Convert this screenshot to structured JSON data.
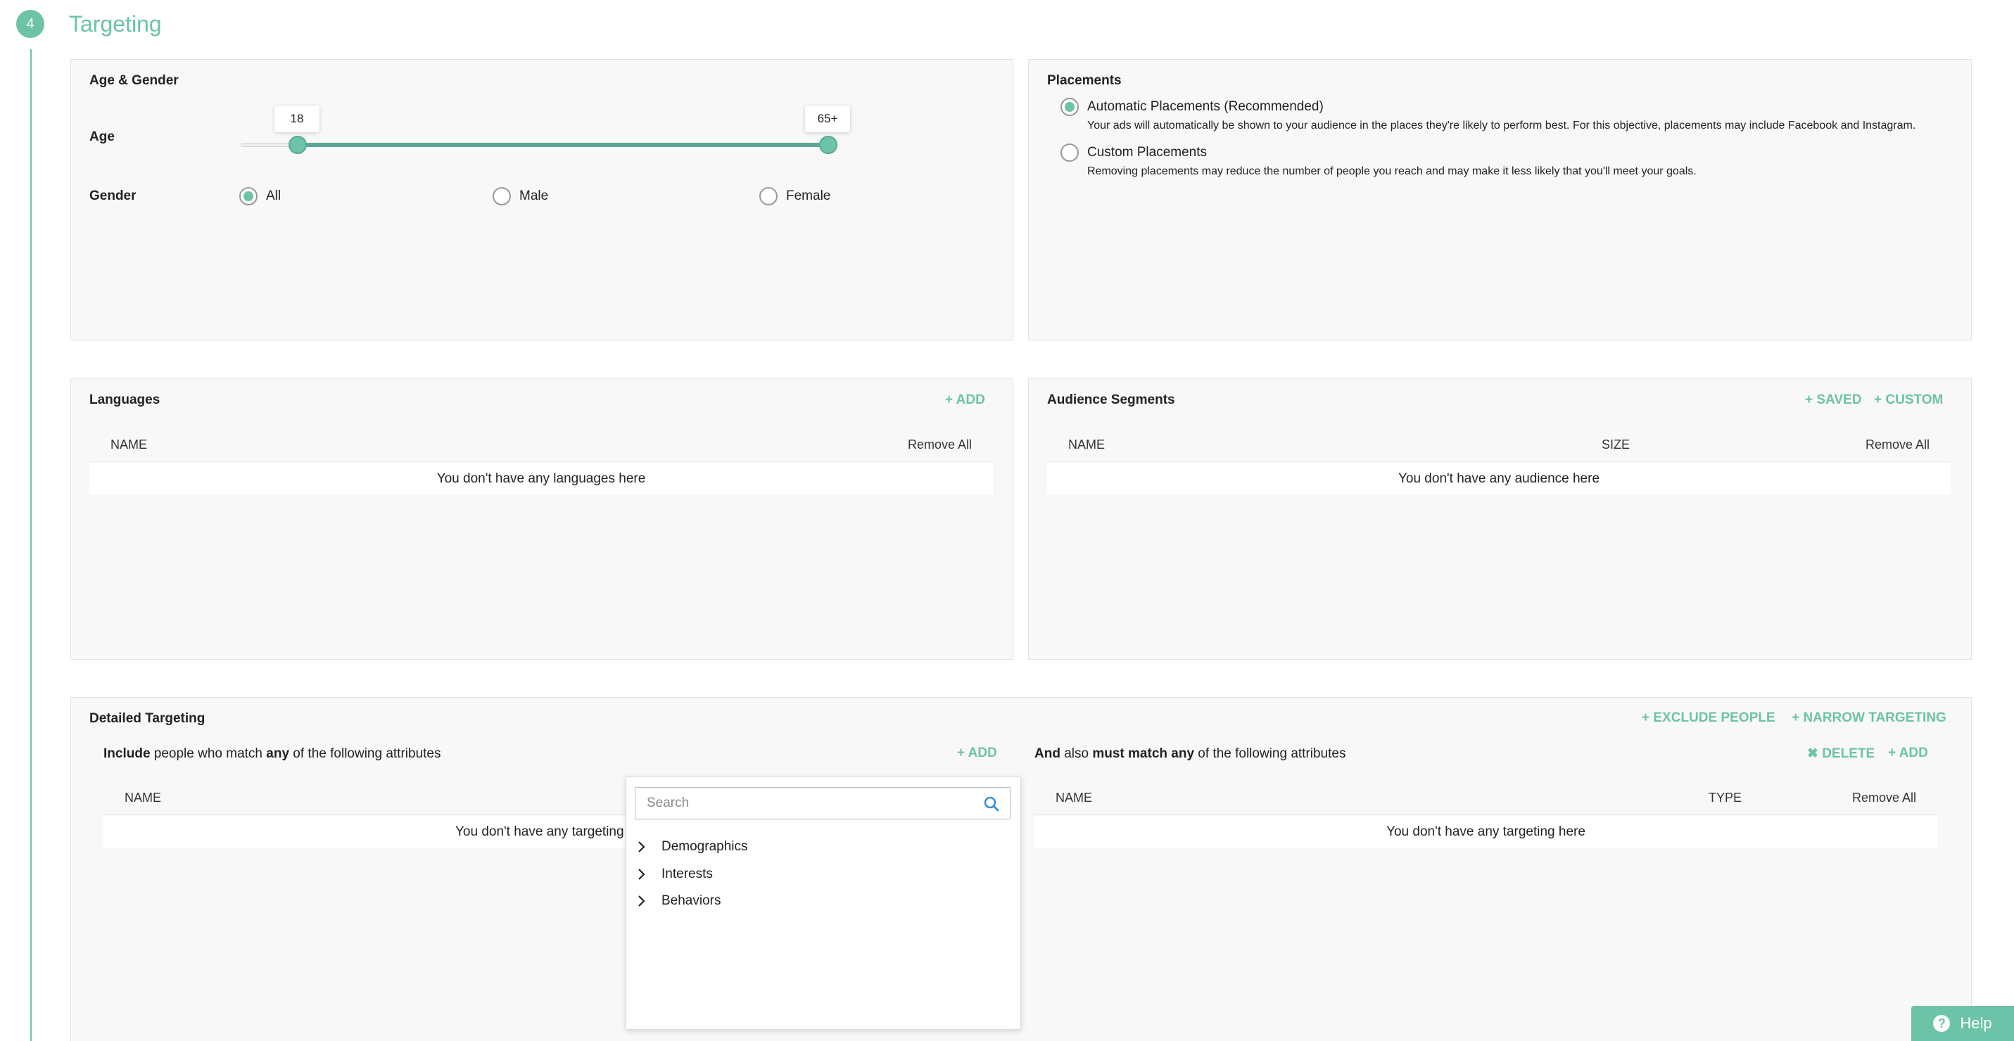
{
  "step": {
    "number": "4",
    "title": "Targeting"
  },
  "age_gender": {
    "title": "Age & Gender",
    "age_label": "Age",
    "age_min": "18",
    "age_max": "65+",
    "gender_label": "Gender",
    "gender_options": [
      "All",
      "Male",
      "Female"
    ],
    "gender_selected": "All"
  },
  "placements": {
    "title": "Placements",
    "options": [
      {
        "label": "Automatic Placements (Recommended)",
        "desc": "Your ads will automatically be shown to your audience in the places they're likely to perform best. For this objective, placements may include Facebook and Instagram.",
        "selected": true
      },
      {
        "label": "Custom Placements",
        "desc": "Removing placements may reduce the number of people you reach and may make it less likely that you'll meet your goals.",
        "selected": false
      }
    ]
  },
  "languages": {
    "title": "Languages",
    "add_label": "+ ADD",
    "col_name": "NAME",
    "remove_all": "Remove All",
    "empty": "You don't have any languages here"
  },
  "audience": {
    "title": "Audience Segments",
    "saved_label": "+ SAVED",
    "custom_label": "+ CUSTOM",
    "col_name": "NAME",
    "col_size": "SIZE",
    "remove_all": "Remove All",
    "empty": "You don't have any audience here"
  },
  "detailed": {
    "title": "Detailed Targeting",
    "exclude_label": "+ EXCLUDE PEOPLE",
    "narrow_label": "+ NARROW TARGETING",
    "include": {
      "w1": "Include",
      "t1": " people who match ",
      "w2": "any",
      "t2": " of the following attributes",
      "add_label": "+ ADD",
      "col_name": "NAME",
      "empty": "You don't have any targeting"
    },
    "must": {
      "w1": "And",
      "t1": " also ",
      "w2": "must match any",
      "t2": " of the following attributes",
      "delete_label": "✖ DELETE",
      "add_label": "+ ADD",
      "col_name": "NAME",
      "col_type": "TYPE",
      "remove_all": "Remove All",
      "empty": "You don't have any targeting here"
    }
  },
  "dropdown": {
    "search_placeholder": "Search",
    "items": [
      "Demographics",
      "Interests",
      "Behaviors"
    ]
  },
  "help": {
    "label": "Help"
  },
  "colors": {
    "accent": "#6cc3a7",
    "accent_dark": "#5ba896",
    "panel_bg": "#f8f8f8",
    "border": "#e3e3e3"
  },
  "slider": {
    "min_fraction": 0.0,
    "max_fraction": 1.0
  }
}
